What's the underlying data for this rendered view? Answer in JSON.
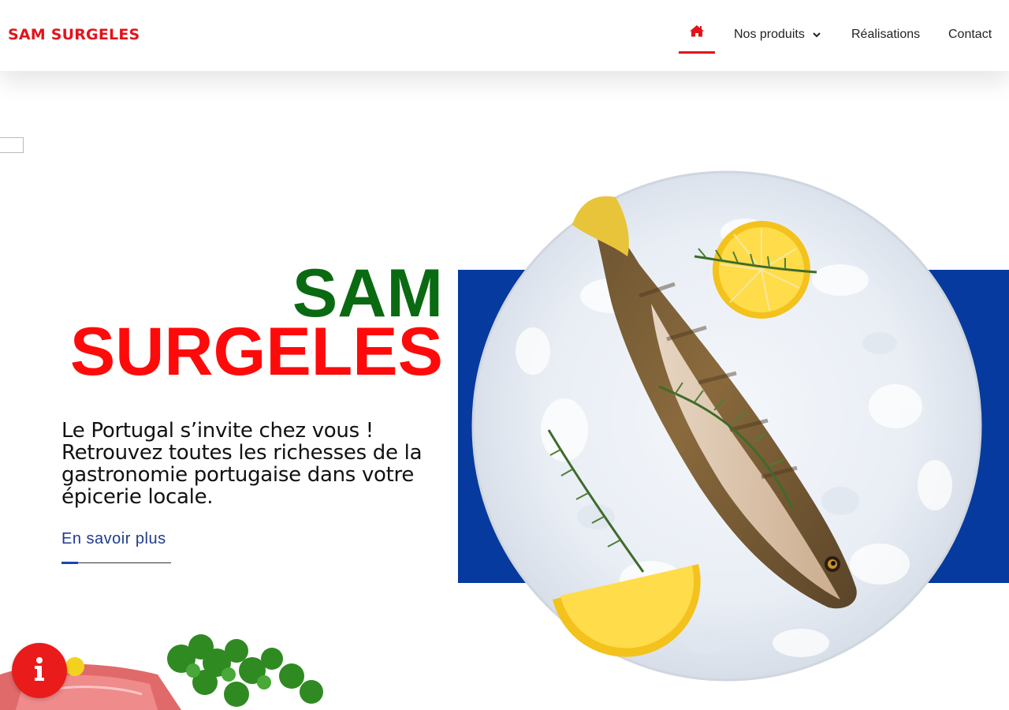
{
  "brand": {
    "logo_text": "SAM SURGELES",
    "red": "#e3131b",
    "green": "#0a6a12",
    "blue": "#063a9e"
  },
  "nav": {
    "home_icon": "home-icon",
    "items": [
      {
        "label": "Nos produits",
        "icon": "chevron-down-icon"
      },
      {
        "label": "Réalisations"
      },
      {
        "label": "Contact"
      }
    ]
  },
  "hero": {
    "title_line1": "SAM",
    "title_line2": "SURGELES",
    "description": "Le Portugal s’invite chez vous ! Retrouvez toutes les richesses de la gastronomie portugaise dans votre épicerie locale.",
    "cta_label": "En savoir plus"
  },
  "widgets": {
    "info_icon": "info-icon"
  }
}
